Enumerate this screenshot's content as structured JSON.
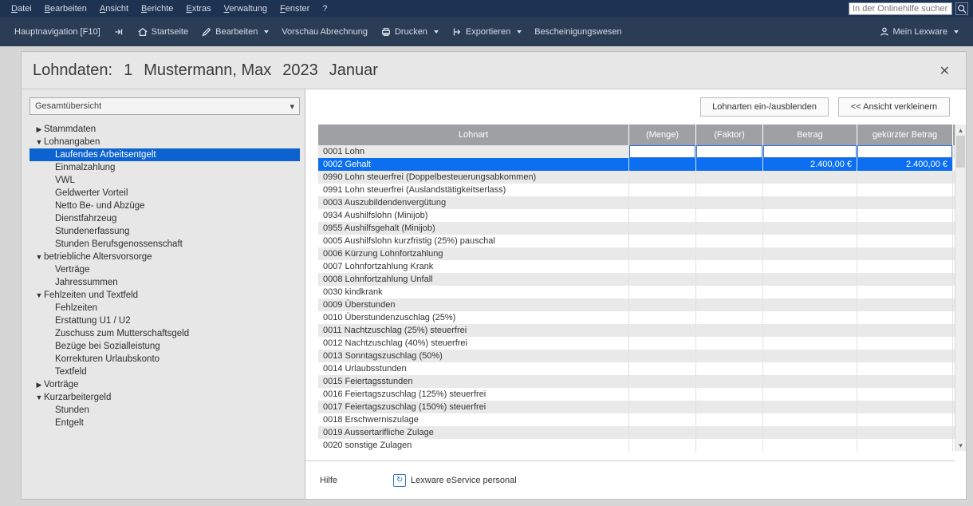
{
  "menubar": {
    "items": [
      "Datei",
      "Bearbeiten",
      "Ansicht",
      "Berichte",
      "Extras",
      "Verwaltung",
      "Fenster",
      "?"
    ],
    "search_placeholder": "In der Onlinehilfe suchen"
  },
  "toolbar": {
    "hauptnav": "Hauptnavigation [F10]",
    "startseite": "Startseite",
    "bearbeiten": "Bearbeiten",
    "vorschau": "Vorschau Abrechnung",
    "drucken": "Drucken",
    "exportieren": "Exportieren",
    "besch": "Bescheinigungswesen",
    "mein_lexware": "Mein Lexware"
  },
  "panel": {
    "title_prefix": "Lohndaten:",
    "nr": "1",
    "name": "Mustermann, Max",
    "year": "2023",
    "month": "Januar"
  },
  "combo": {
    "value": "Gesamtübersicht"
  },
  "tree": [
    {
      "lvl": 1,
      "exp": "closed",
      "label": "Stammdaten"
    },
    {
      "lvl": 1,
      "exp": "open",
      "label": "Lohnangaben"
    },
    {
      "lvl": 2,
      "exp": "",
      "label": "Laufendes Arbeitsentgelt",
      "sel": true
    },
    {
      "lvl": 2,
      "exp": "",
      "label": "Einmalzahlung"
    },
    {
      "lvl": 2,
      "exp": "",
      "label": "VWL"
    },
    {
      "lvl": 2,
      "exp": "",
      "label": "Geldwerter Vorteil"
    },
    {
      "lvl": 2,
      "exp": "",
      "label": "Netto Be- und Abzüge"
    },
    {
      "lvl": 2,
      "exp": "",
      "label": "Dienstfahrzeug"
    },
    {
      "lvl": 2,
      "exp": "",
      "label": "Stundenerfassung"
    },
    {
      "lvl": 2,
      "exp": "",
      "label": "Stunden Berufsgenossenschaft"
    },
    {
      "lvl": 1,
      "exp": "open",
      "label": "betriebliche Altersvorsorge"
    },
    {
      "lvl": 2,
      "exp": "",
      "label": "Verträge"
    },
    {
      "lvl": 2,
      "exp": "",
      "label": "Jahressummen"
    },
    {
      "lvl": 1,
      "exp": "open",
      "label": "Fehlzeiten und Textfeld"
    },
    {
      "lvl": 2,
      "exp": "",
      "label": "Fehlzeiten"
    },
    {
      "lvl": 2,
      "exp": "",
      "label": "Erstattung U1 / U2"
    },
    {
      "lvl": 2,
      "exp": "",
      "label": "Zuschuss zum Mutterschaftsgeld"
    },
    {
      "lvl": 2,
      "exp": "",
      "label": "Bezüge bei Sozialleistung"
    },
    {
      "lvl": 2,
      "exp": "",
      "label": "Korrekturen Urlaubskonto"
    },
    {
      "lvl": 2,
      "exp": "",
      "label": "Textfeld"
    },
    {
      "lvl": 1,
      "exp": "closed",
      "label": "Vorträge"
    },
    {
      "lvl": 1,
      "exp": "open",
      "label": "Kurzarbeitergeld"
    },
    {
      "lvl": 2,
      "exp": "",
      "label": "Stunden"
    },
    {
      "lvl": 2,
      "exp": "",
      "label": "Entgelt"
    }
  ],
  "actions": {
    "ein_aus": "Lohnarten ein-/ausblenden",
    "verkleinern": "<<  Ansicht verkleinern"
  },
  "grid": {
    "cols": [
      "Lohnart",
      "(Menge)",
      "(Faktor)",
      "Betrag",
      "gekürzter Betrag"
    ],
    "rows": [
      {
        "c0": "0001 Lohn",
        "editing": true
      },
      {
        "c0": "0002 Gehalt",
        "c3": "2.400,00 €",
        "c4": "2.400,00 €",
        "selected": true
      },
      {
        "c0": "0990 Lohn steuerfrei (Doppelbesteuerungsabkommen)"
      },
      {
        "c0": "0991 Lohn steuerfrei (Auslandstätigkeitserlass)"
      },
      {
        "c0": "0003 Auszubildendenvergütung"
      },
      {
        "c0": "0934 Aushilfslohn (Minijob)"
      },
      {
        "c0": "0955 Aushilfsgehalt (Minijob)"
      },
      {
        "c0": "0005 Aushilfslohn kurzfristig (25%) pauschal"
      },
      {
        "c0": "0006 Kürzung Lohnfortzahlung"
      },
      {
        "c0": "0007 Lohnfortzahlung Krank"
      },
      {
        "c0": "0008 Lohnfortzahlung Unfall"
      },
      {
        "c0": "0030 kindkrank"
      },
      {
        "c0": "0009 Überstunden"
      },
      {
        "c0": "0010 Überstundenzuschlag (25%)"
      },
      {
        "c0": "0011 Nachtzuschlag (25%) steuerfrei"
      },
      {
        "c0": "0012 Nachtzuschlag (40%) steuerfrei"
      },
      {
        "c0": "0013 Sonntagszuschlag (50%)"
      },
      {
        "c0": "0014 Urlaubsstunden"
      },
      {
        "c0": "0015 Feiertagsstunden"
      },
      {
        "c0": "0016 Feiertagszuschlag (125%) steuerfrei"
      },
      {
        "c0": "0017 Feiertagszuschlag (150%) steuerfrei"
      },
      {
        "c0": "0018 Erschwerniszulage"
      },
      {
        "c0": "0019 Aussertarifliche Zulage"
      },
      {
        "c0": "0020 sonstige Zulagen"
      }
    ]
  },
  "footer": {
    "hilfe": "Hilfe",
    "eservice": "Lexware eService personal"
  }
}
